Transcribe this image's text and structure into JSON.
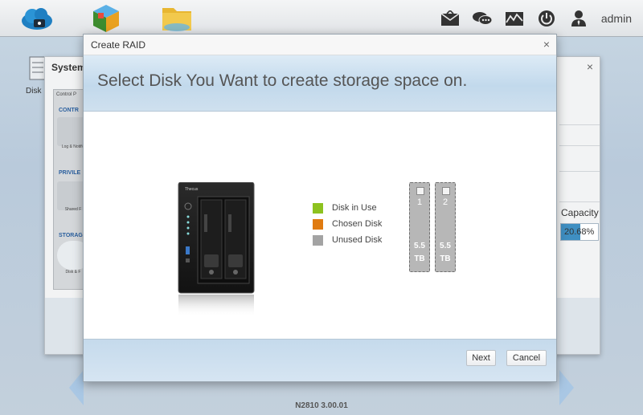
{
  "topbar": {
    "username": "admin",
    "app_icons": [
      "cloud-icon",
      "app-center-icon",
      "file-manager-icon"
    ],
    "right_icons": [
      "mail-icon",
      "chat-icon",
      "monitor-icon",
      "power-icon",
      "user-icon"
    ]
  },
  "background_window": {
    "title": "System",
    "desktop_icon_label": "Disk",
    "control_panel_title": "Control P",
    "sections": [
      "CONTR",
      "PRIVILE",
      "STORAG"
    ],
    "items": [
      "Log &\nNotific",
      "Shared F",
      "Disk & F"
    ],
    "column_header": "Capacity",
    "capacity_value": "20.68%",
    "capacity_percent": 53
  },
  "modal": {
    "title": "Create RAID",
    "close_label": "×",
    "heading": "Select Disk You Want to create storage space on.",
    "legend": [
      {
        "label": "Disk in Use",
        "color": "#8dc21f"
      },
      {
        "label": "Chosen Disk",
        "color": "#e07b10"
      },
      {
        "label": "Unused Disk",
        "color": "#a3a3a3"
      }
    ],
    "disks": [
      {
        "number": "1",
        "size_line1": "5.5",
        "size_line2": "TB"
      },
      {
        "number": "2",
        "size_line1": "5.5",
        "size_line2": "TB"
      }
    ],
    "device_brand": "Thecus",
    "buttons": {
      "next": "Next",
      "cancel": "Cancel"
    }
  },
  "footer": {
    "version": "N2810    3.00.01"
  }
}
